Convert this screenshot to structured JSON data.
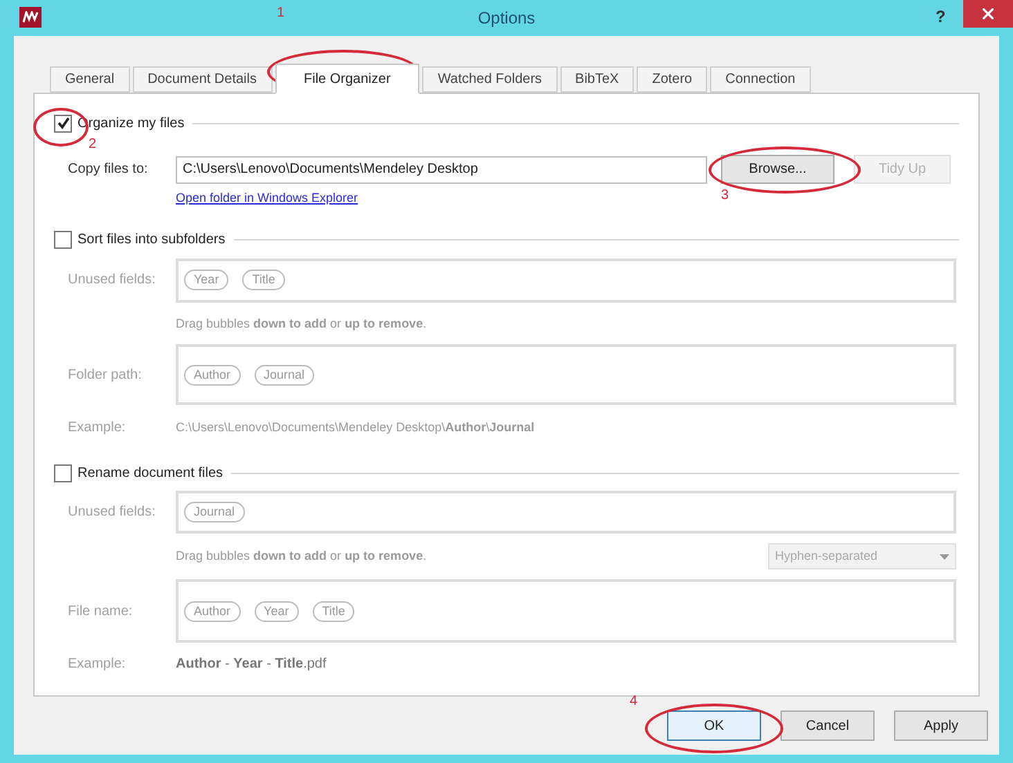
{
  "window": {
    "title": "Options",
    "help": "?"
  },
  "tabs": [
    {
      "label": "General",
      "selected": false
    },
    {
      "label": "Document Details",
      "selected": false
    },
    {
      "label": "File Organizer",
      "selected": true
    },
    {
      "label": "Watched Folders",
      "selected": false
    },
    {
      "label": "BibTeX",
      "selected": false
    },
    {
      "label": "Zotero",
      "selected": false
    },
    {
      "label": "Connection",
      "selected": false
    }
  ],
  "organize": {
    "label": "Organize my files",
    "checked": true,
    "copy_label": "Copy files to:",
    "path": "C:\\Users\\Lenovo\\Documents\\Mendeley Desktop",
    "browse": "Browse...",
    "tidy_up": {
      "label": "Tidy Up",
      "disabled": true
    },
    "link": "Open folder in Windows Explorer"
  },
  "sort": {
    "label": "Sort files into subfolders",
    "checked": false,
    "unused_label": "Unused fields:",
    "unused": [
      "Year",
      "Title"
    ],
    "hint": "Drag bubbles **down to add** or **up to remove**.",
    "path_label": "Folder path:",
    "path": [
      "Author",
      "Journal"
    ],
    "example_label": "Example:",
    "example": "C:\\Users\\Lenovo\\Documents\\Mendeley Desktop\\**Author**\\**Journal**"
  },
  "rename": {
    "label": "Rename document files",
    "checked": false,
    "unused_label": "Unused fields:",
    "unused": [
      "Journal"
    ],
    "hint": "Drag bubbles **down to add** or **up to remove**.",
    "separator": "Hyphen-separated",
    "name_label": "File name:",
    "name": [
      "Author",
      "Year",
      "Title"
    ],
    "example_label": "Example:",
    "example": "**Author** - **Year** - **Title**.pdf"
  },
  "buttons": [
    "OK",
    "Cancel",
    "Apply"
  ],
  "annotations": [
    "1",
    "2",
    "3",
    "4"
  ]
}
